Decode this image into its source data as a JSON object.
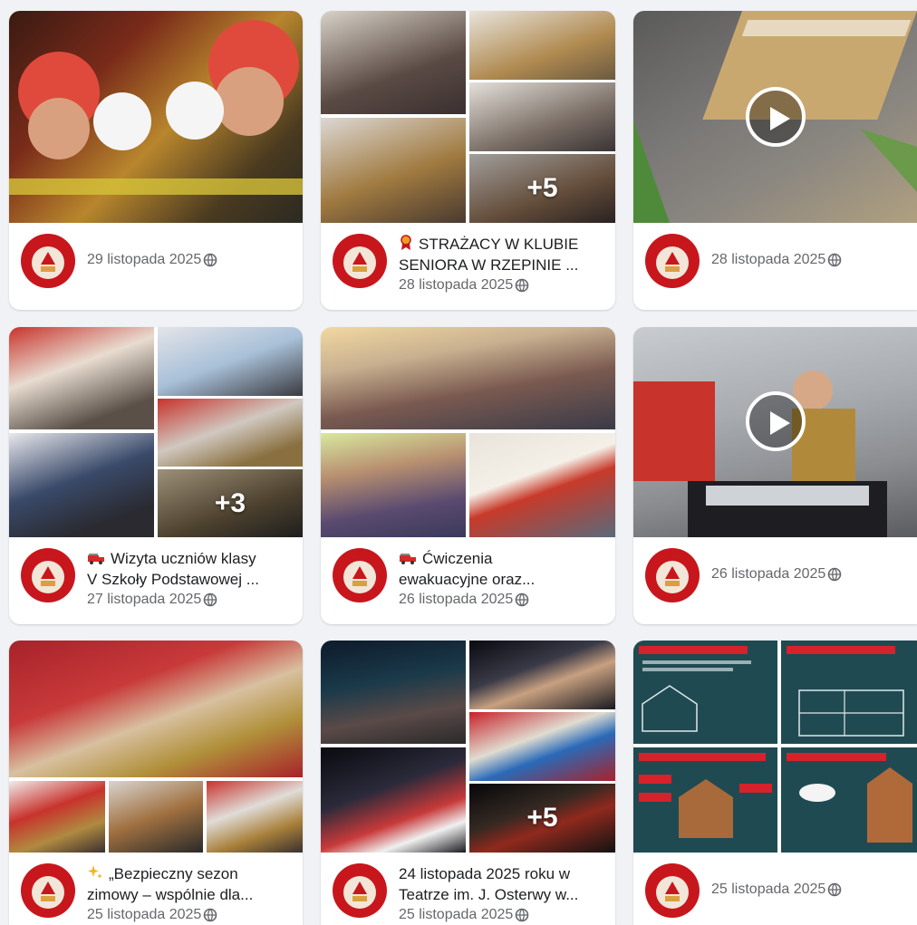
{
  "colors": {
    "page_bg": "#f0f2f5",
    "card_bg": "#ffffff",
    "text_primary": "#1c1e21",
    "text_secondary": "#65676b",
    "brand_red": "#c8161d"
  },
  "posts": [
    {
      "title_icon": "",
      "title": "",
      "date": "29 listopada 2025",
      "privacy_icon": "globe-icon",
      "media": {
        "type": "photo",
        "tiles": 1,
        "more_count": ""
      }
    },
    {
      "title_icon": "badge-icon",
      "title_line1": "STRAŻACY W KLUBIE",
      "title_line2": "SENIORA W RZEPINIE ...",
      "date": "28 listopada 2025",
      "privacy_icon": "globe-icon",
      "media": {
        "type": "album",
        "tiles": 5,
        "more_count": "+5"
      }
    },
    {
      "title": "",
      "date": "28 listopada 2025",
      "privacy_icon": "globe-icon",
      "media": {
        "type": "video",
        "tiles": 1,
        "more_count": ""
      }
    },
    {
      "title_icon": "fire-truck-icon",
      "title_line1": "Wizyta uczniów klasy",
      "title_line2": "V Szkoły Podstawowej ...",
      "date": "27 listopada 2025",
      "privacy_icon": "globe-icon",
      "media": {
        "type": "album",
        "tiles": 5,
        "more_count": "+3"
      }
    },
    {
      "title_icon": "fire-truck-icon",
      "title_line1": "Ćwiczenia",
      "title_line2": "ewakuacyjne oraz...",
      "date": "26 listopada 2025",
      "privacy_icon": "globe-icon",
      "media": {
        "type": "album",
        "tiles": 3,
        "more_count": ""
      }
    },
    {
      "title": "",
      "date": "26 listopada 2025",
      "privacy_icon": "globe-icon",
      "media": {
        "type": "video",
        "tiles": 1,
        "more_count": ""
      }
    },
    {
      "title_icon": "sparkles-icon",
      "title_line1": "„Bezpieczny sezon",
      "title_line2": "zimowy – wspólnie dla...",
      "date": "25 listopada 2025",
      "privacy_icon": "globe-icon",
      "media": {
        "type": "album",
        "tiles": 4,
        "more_count": ""
      }
    },
    {
      "title_icon": "",
      "title_line1": "24 listopada 2025 roku w",
      "title_line2": "Teatrze im. J. Osterwy w...",
      "date": "25 listopada 2025",
      "privacy_icon": "globe-icon",
      "media": {
        "type": "album",
        "tiles": 5,
        "more_count": "+5"
      }
    },
    {
      "title": "",
      "date": "25 listopada 2025",
      "privacy_icon": "globe-icon",
      "media": {
        "type": "album",
        "tiles": 4,
        "more_count": ""
      }
    }
  ]
}
